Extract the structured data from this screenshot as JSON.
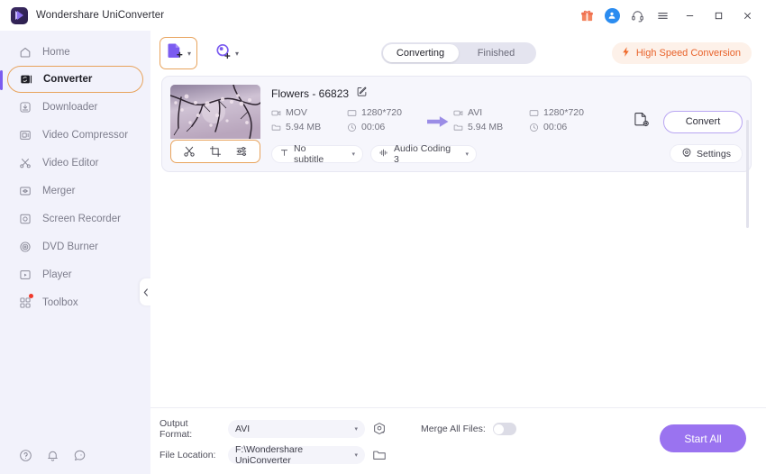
{
  "titlebar": {
    "app_name": "Wondershare UniConverter",
    "logo_icon": "uniconverter-logo-icon",
    "icons": [
      {
        "name": "gift-icon",
        "glyph": "gift"
      },
      {
        "name": "account-avatar-icon",
        "glyph": "user"
      },
      {
        "name": "support-headset-icon",
        "glyph": "headset"
      },
      {
        "name": "menu-hamburger-icon",
        "glyph": "menu"
      }
    ],
    "window_controls": {
      "minimize": "minimize-icon",
      "maximize": "maximize-icon",
      "close": "close-icon"
    }
  },
  "sidebar": {
    "items": [
      {
        "label": "Home",
        "icon": "home-icon",
        "active": false,
        "badge": false
      },
      {
        "label": "Converter",
        "icon": "converter-icon",
        "active": true,
        "badge": false
      },
      {
        "label": "Downloader",
        "icon": "downloader-icon",
        "active": false,
        "badge": false
      },
      {
        "label": "Video Compressor",
        "icon": "video-compressor-icon",
        "active": false,
        "badge": false
      },
      {
        "label": "Video Editor",
        "icon": "video-editor-icon",
        "active": false,
        "badge": false
      },
      {
        "label": "Merger",
        "icon": "merger-icon",
        "active": false,
        "badge": false
      },
      {
        "label": "Screen Recorder",
        "icon": "screen-recorder-icon",
        "active": false,
        "badge": false
      },
      {
        "label": "DVD Burner",
        "icon": "dvd-burner-icon",
        "active": false,
        "badge": false
      },
      {
        "label": "Player",
        "icon": "player-icon",
        "active": false,
        "badge": false
      },
      {
        "label": "Toolbox",
        "icon": "toolbox-icon",
        "active": false,
        "badge": true
      }
    ],
    "collapse_icon": "collapse-sidebar-icon",
    "bottom_icons": [
      {
        "name": "help-icon"
      },
      {
        "name": "notification-bell-icon"
      },
      {
        "name": "feedback-icon"
      }
    ]
  },
  "toolbar": {
    "add_files": {
      "label": "",
      "icon": "add-file-icon",
      "caret": "▾"
    },
    "add_device": {
      "label": "",
      "icon": "add-from-device-icon",
      "caret": "▾"
    },
    "tabs": [
      {
        "label": "Converting",
        "active": true
      },
      {
        "label": "Finished",
        "active": false
      }
    ],
    "high_speed": {
      "label": "High Speed Conversion",
      "icon": "lightning-bolt-icon"
    }
  },
  "file_card": {
    "title": "Flowers - 66823",
    "rename_icon": "edit-rename-icon",
    "thumbnail_alt": "cherry-blossom-video-thumbnail",
    "thumb_tools": [
      {
        "name": "trim-scissors-icon"
      },
      {
        "name": "crop-icon"
      },
      {
        "name": "effect-adjust-icon"
      }
    ],
    "source": {
      "format": "MOV",
      "resolution": "1280*720",
      "size": "5.94 MB",
      "duration": "00:06"
    },
    "target": {
      "format": "AVI",
      "resolution": "1280*720",
      "size": "5.94 MB",
      "duration": "00:06"
    },
    "arrow_icon": "conversion-arrow-icon",
    "file_settings_icon": "output-file-settings-icon",
    "convert_label": "Convert",
    "subtitle_select": {
      "value": "No subtitle",
      "icon": "subtitle-icon",
      "caret": "▾"
    },
    "audio_select": {
      "value": "Audio Coding 3",
      "icon": "audio-waveform-icon",
      "caret": "▾"
    },
    "settings_button": {
      "label": "Settings",
      "icon": "settings-gear-icon"
    }
  },
  "bottom_bar": {
    "output_format": {
      "label": "Output Format:",
      "value": "AVI",
      "caret": "▾",
      "side_icon": "format-preview-icon"
    },
    "file_location": {
      "label": "File Location:",
      "value": "F:\\Wondershare UniConverter",
      "caret": "▾",
      "side_icon": "open-folder-icon"
    },
    "merge": {
      "label": "Merge All Files:",
      "enabled": false
    },
    "start_all": "Start All"
  },
  "colors": {
    "accent_purple": "#9a73f0",
    "sidebar_bg": "#f2f2fb",
    "highlight_orange": "#e8a35c",
    "high_speed_orange": "#e8622a",
    "card_bg": "#f6f6fc"
  }
}
